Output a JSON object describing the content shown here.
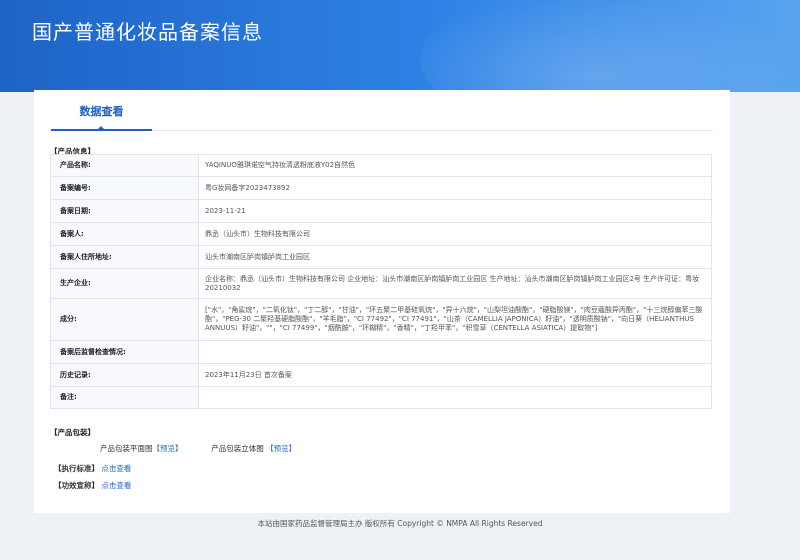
{
  "header": {
    "title": "国产普通化妆品备案信息"
  },
  "tabs": [
    {
      "label": "数据查看"
    }
  ],
  "product_info": {
    "section_title": "【产品信息】",
    "rows": [
      {
        "label": "产品名称:",
        "value": "YAQINUO雅琪诺空气持妆清透粉底液Y02自然色"
      },
      {
        "label": "备案编号:",
        "value": "粤G妆网备字2023473892"
      },
      {
        "label": "备案日期:",
        "value": "2023-11-21"
      },
      {
        "label": "备案人:",
        "value": "鼎丞（汕头市）生物科技有限公司"
      },
      {
        "label": "备案人住所地址:",
        "value": "汕头市潮南区胪岗镇胪岗工业园区"
      },
      {
        "label": "生产企业:",
        "value": "企业名称：鼎丞（汕头市）生物科技有限公司 企业地址：汕头市潮南区胪岗镇胪岗工业园区 生产地址：汕头市潮南区胪岗镇胪岗工业园区2号 生产许可证：粤妆20210032"
      },
      {
        "label": "成分:",
        "value": "[\"水\"，\"角鲨烷\"，\"二氧化钛\"，\"丁二醇\"，\"甘油\"，\"环五聚二甲基硅氧烷\"，\"异十六烷\"，\"山梨坦油酸酯\"，\"硬脂酸镁\"，\"肉豆蔻酸异丙酯\"，\"十三烷醇偏苯三酸酯\"，\"PEG-30 二聚羟基硬脂酸酯\"，\"羊毛脂\"，\"CI 77492\"，\"CI 77491\"，\"山茶（CAMELLIA JAPONICA）籽油\"，\"透明质酸钠\"，\"向日葵（HELIANTHUS ANNUUS）籽油\"，\"\"，\"CI 77499\"，\"烟酰胺\"，\"环糊精\"，\"香精\"，\"丁羟甲苯\"，\"积雪草（CENTELLA ASIATICA）提取物\"]"
      },
      {
        "label": "备案后监督检查情况:",
        "value": ""
      },
      {
        "label": "历史记录:",
        "value": "2023年11月23日 首次备案"
      },
      {
        "label": "备注:",
        "value": ""
      }
    ]
  },
  "packaging": {
    "section_title": "【产品包装】",
    "flat_label": "产品包装平面图",
    "flat_link": "【预览】",
    "solid_label": "产品包装立体图",
    "solid_link": "【预览】"
  },
  "standard": {
    "section_title": "【执行标准】",
    "link": "点击查看"
  },
  "efficacy": {
    "section_title": "【功效宣称】",
    "link": "点击查看"
  },
  "footer": {
    "text": "本站由国家药品监督管理局主办 版权所有 Copyright © NMPA All Rights Reserved"
  }
}
